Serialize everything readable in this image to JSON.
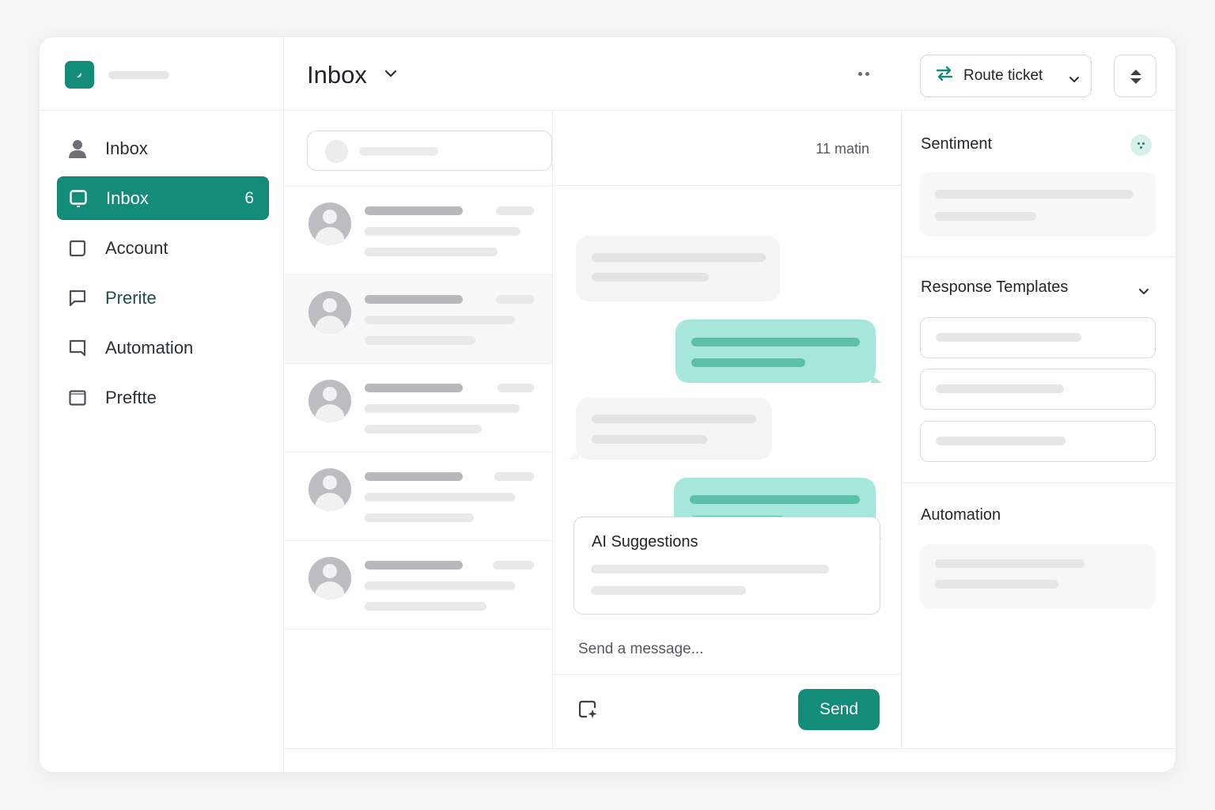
{
  "sidebar": {
    "items": [
      {
        "label": "Inbox",
        "icon": "user-icon",
        "count": ""
      },
      {
        "label": "Inbox",
        "icon": "inbox-icon",
        "count": "6"
      },
      {
        "label": "Account",
        "icon": "account-icon",
        "count": ""
      },
      {
        "label": "Prerite",
        "icon": "chat-icon",
        "count": ""
      },
      {
        "label": "Automation",
        "icon": "bookmark-icon",
        "count": ""
      },
      {
        "label": "Preftte",
        "icon": "window-icon",
        "count": ""
      }
    ]
  },
  "header": {
    "title": "Inbox",
    "more_icon": "more-dots-icon"
  },
  "chat": {
    "timestamp": "11 matin",
    "ai_suggestions_title": "AI Suggestions",
    "compose_placeholder": "Send a message...",
    "send_label": "Send"
  },
  "right_panel": {
    "route_label": "Route ticket",
    "sentiment_title": "Sentiment",
    "templates_title": "Response Templates",
    "automation_title": "Automation"
  },
  "colors": {
    "accent": "#138d7a",
    "outgoing_bubble": "#a7e6da",
    "incoming_bubble": "#f5f5f5"
  }
}
